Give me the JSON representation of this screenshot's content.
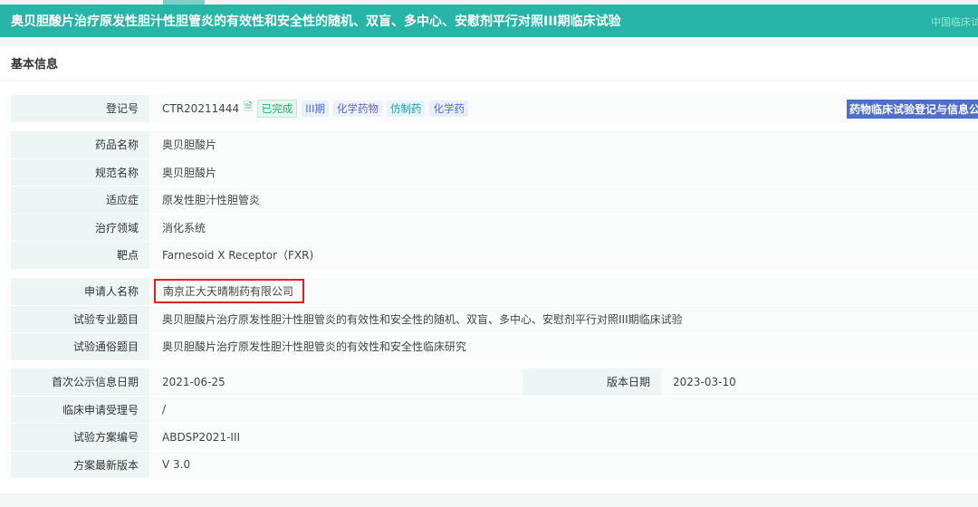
{
  "header": {
    "title": "奥贝胆酸片治疗原发性胆汁性胆管炎的有效性和安全性的随机、双盲、多中心、安慰剂平行对照III期临床试验",
    "right_text": "中国临床试"
  },
  "section_title": "基本信息",
  "registration": {
    "label": "登记号",
    "value": "CTR20211444",
    "tags": [
      "已完成",
      "III期",
      "化学药物",
      "仿制药",
      "化学药"
    ],
    "publish_button": "药物临床试验登记与信息公示平台"
  },
  "drug": [
    {
      "label": "药品名称",
      "value": "奥贝胆酸片"
    },
    {
      "label": "规范名称",
      "value": "奥贝胆酸片"
    },
    {
      "label": "适应症",
      "value": "原发性胆汁性胆管炎"
    },
    {
      "label": "治疗领域",
      "value": "消化系统"
    },
    {
      "label": "靶点",
      "value": "Farnesoid X Receptor（FXR)"
    }
  ],
  "applicant": [
    {
      "label": "申请人名称",
      "value": "南京正大天晴制药有限公司"
    },
    {
      "label": "试验专业题目",
      "value": "奥贝胆酸片治疗原发性胆汁性胆管炎的有效性和安全性的随机、双盲、多中心、安慰剂平行对照III期临床试验"
    },
    {
      "label": "试验通俗题目",
      "value": "奥贝胆酸片治疗原发性胆汁性胆管炎的有效性和安全性临床研究"
    }
  ],
  "dates": {
    "first_label": "首次公示信息日期",
    "first_value": "2021-06-25",
    "version_label": "版本日期",
    "version_value": "2023-03-10"
  },
  "protocol": [
    {
      "label": "临床申请受理号",
      "value": "/"
    },
    {
      "label": "试验方案编号",
      "value": "ABDSP2021-III"
    },
    {
      "label": "方案最新版本",
      "value": "V 3.0"
    }
  ]
}
